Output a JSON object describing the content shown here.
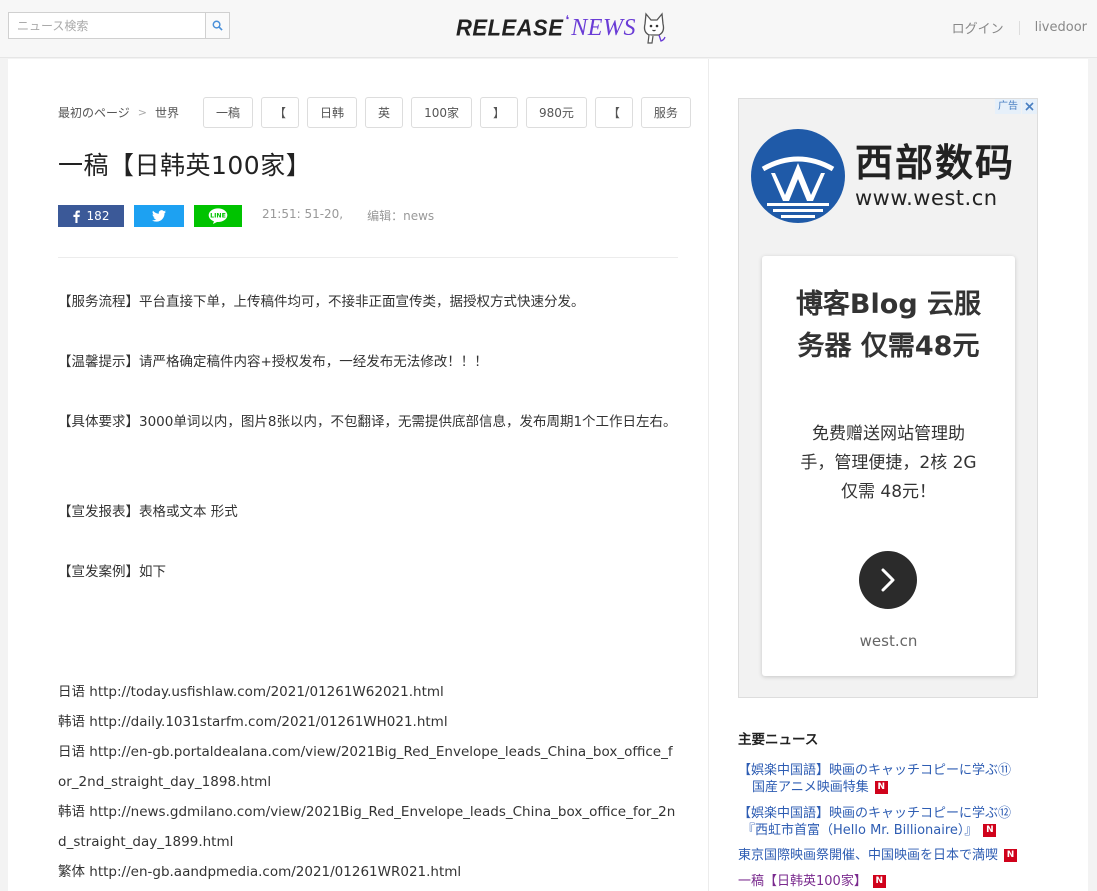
{
  "header": {
    "search_placeholder": "ニュース検索",
    "logo_release": "RELEASE",
    "logo_news": "NEWS",
    "login": "ログイン",
    "livedoor": "livedoor"
  },
  "breadcrumb": {
    "home": "最初のページ",
    "separator": ">",
    "category": "世界"
  },
  "tags": [
    "一稿",
    "【",
    "日韩",
    "英",
    "100家",
    "】",
    "980元",
    "【",
    "服务"
  ],
  "article": {
    "title": "一稿【日韩英100家】",
    "fb_count": "182",
    "time": "21:51: 51-20,",
    "editor": "编辑：news",
    "paragraphs": [
      "【服务流程】平台直接下单，上传稿件均可，不接非正面宣传类，据授权方式快速分发。",
      "【温馨提示】请严格确定稿件内容+授权发布，一经发布无法修改！！！",
      "【具体要求】3000单词以内，图片8张以内，不包翻译，无需提供底部信息，发布周期1个工作日左右。",
      "【宣发报表】表格或文本 形式",
      "【宣发案例】如下"
    ],
    "links": [
      "日语 http://today.usfishlaw.com/2021/01261W62021.html",
      "韩语 http://daily.1031starfm.com/2021/01261WH021.html",
      "日语 http://en-gb.portaldealana.com/view/2021Big_Red_Envelope_leads_China_box_office_for_2nd_straight_day_1898.html",
      "韩语 http://news.gdmilano.com/view/2021Big_Red_Envelope_leads_China_box_office_for_2nd_straight_day_1899.html",
      "繁体 http://en-gb.aandpmedia.com/2021/01261WR021.html"
    ]
  },
  "ad": {
    "label": "广告",
    "brand_cn": "西部数码",
    "brand_url": "www.west.cn",
    "headline_1": "博客Blog 云服",
    "headline_2": "务器 仅需48元",
    "sub_1": "免费赠送网站管理助",
    "sub_2": "手，管理便捷，2核 2G",
    "sub_3": "仅需 48元！",
    "domain": "west.cn",
    "brand_color": "#1f5aa8"
  },
  "news": {
    "heading": "主要ニュース",
    "badge": "N",
    "items": [
      {
        "line1": "【娯楽中国語】映画のキャッチコピーに学ぶ⑪",
        "line2": "国産アニメ映画特集"
      },
      {
        "line1": "【娯楽中国語】映画のキャッチコピーに学ぶ⑫",
        "line2": "『西虹市首富（Hello Mr. Billionaire）』"
      },
      {
        "line1": "東京国際映画祭開催、中国映画を日本で満喫",
        "line2": ""
      },
      {
        "line1": "一稿【日韩英100家】",
        "line2": ""
      }
    ]
  },
  "colors": {
    "facebook": "#3b5998",
    "twitter": "#1da1f2",
    "line": "#00c300",
    "news_badge": "#d0021b",
    "logo_purple": "#6a3cd6"
  }
}
